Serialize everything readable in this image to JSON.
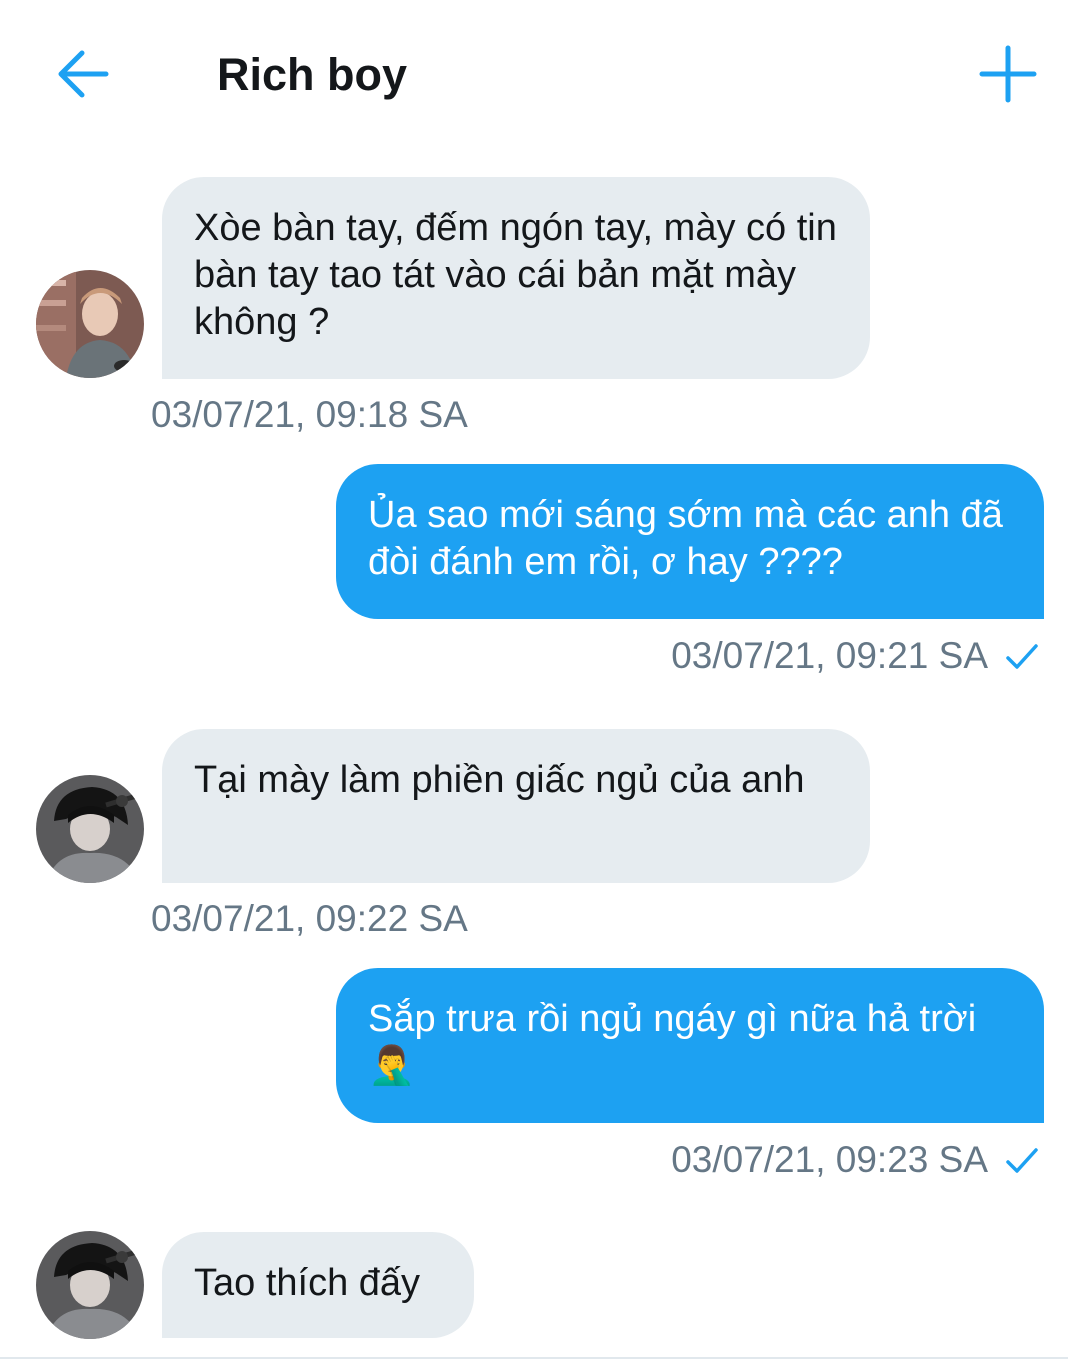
{
  "header": {
    "title": "Rich boy",
    "back_icon": "arrow-left-icon",
    "add_icon": "plus-icon",
    "accent_color": "#1da1f2"
  },
  "messages": [
    {
      "direction": "incoming",
      "text": "Xòe bàn tay, đếm ngón tay, mày có tin bàn tay tao tát vào cái bản mặt mày không ?",
      "time": "03/07/21, 09:18 SA"
    },
    {
      "direction": "outgoing",
      "text": "Ủa sao mới sáng sớm mà các anh đã đòi đánh em rồi, ơ hay ????",
      "time": "03/07/21, 09:21 SA",
      "status_icon": "checkmark-icon"
    },
    {
      "direction": "incoming",
      "text": "Tại mày làm phiền giấc ngủ của anh",
      "time": "03/07/21, 09:22 SA"
    },
    {
      "direction": "outgoing",
      "text": "Sắp trưa rồi ngủ ngáy gì nữa hả trời🤦‍♂️",
      "time": "03/07/21, 09:23 SA",
      "status_icon": "checkmark-icon"
    },
    {
      "direction": "incoming",
      "text": "Tao thích đấy"
    }
  ],
  "colors": {
    "incoming_bubble": "#e6ecf0",
    "outgoing_bubble": "#1da1f2",
    "timestamp": "#657786"
  }
}
